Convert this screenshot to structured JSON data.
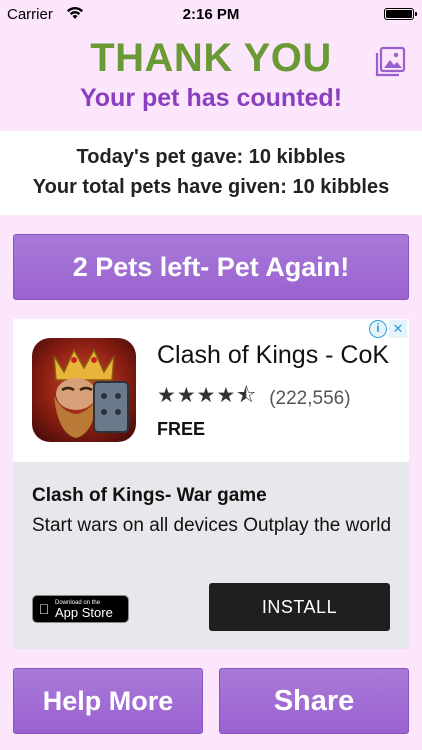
{
  "status_bar": {
    "carrier": "Carrier",
    "time": "2:16 PM"
  },
  "header": {
    "title": "THANK YOU",
    "subtitle": "Your pet has counted!",
    "gallery_icon": "photo-gallery-icon"
  },
  "stats": {
    "today_line": "Today's pet gave: 10 kibbles",
    "total_line": "Your total pets have given: 10 kibbles"
  },
  "pet_again_label": "2 Pets left- Pet Again!",
  "ad": {
    "choices_info": "i",
    "choices_close": "✕",
    "app_name": "Clash of Kings - CoK",
    "stars": "★★★★⯪",
    "rating_value": 4.5,
    "rating_count": "(222,556)",
    "price": "FREE",
    "headline": "Clash of Kings- War game",
    "body": "Start wars on all devices Outplay the world",
    "badge_small": "Download on the",
    "badge_big": "App Store",
    "install_label": "INSTALL"
  },
  "footer": {
    "help_more_label": "Help More",
    "share_label": "Share"
  },
  "colors": {
    "background": "#fbe6fb",
    "title_green": "#6a9a33",
    "subtitle_purple": "#8a3fbe",
    "button_purple": "#a070d4"
  }
}
